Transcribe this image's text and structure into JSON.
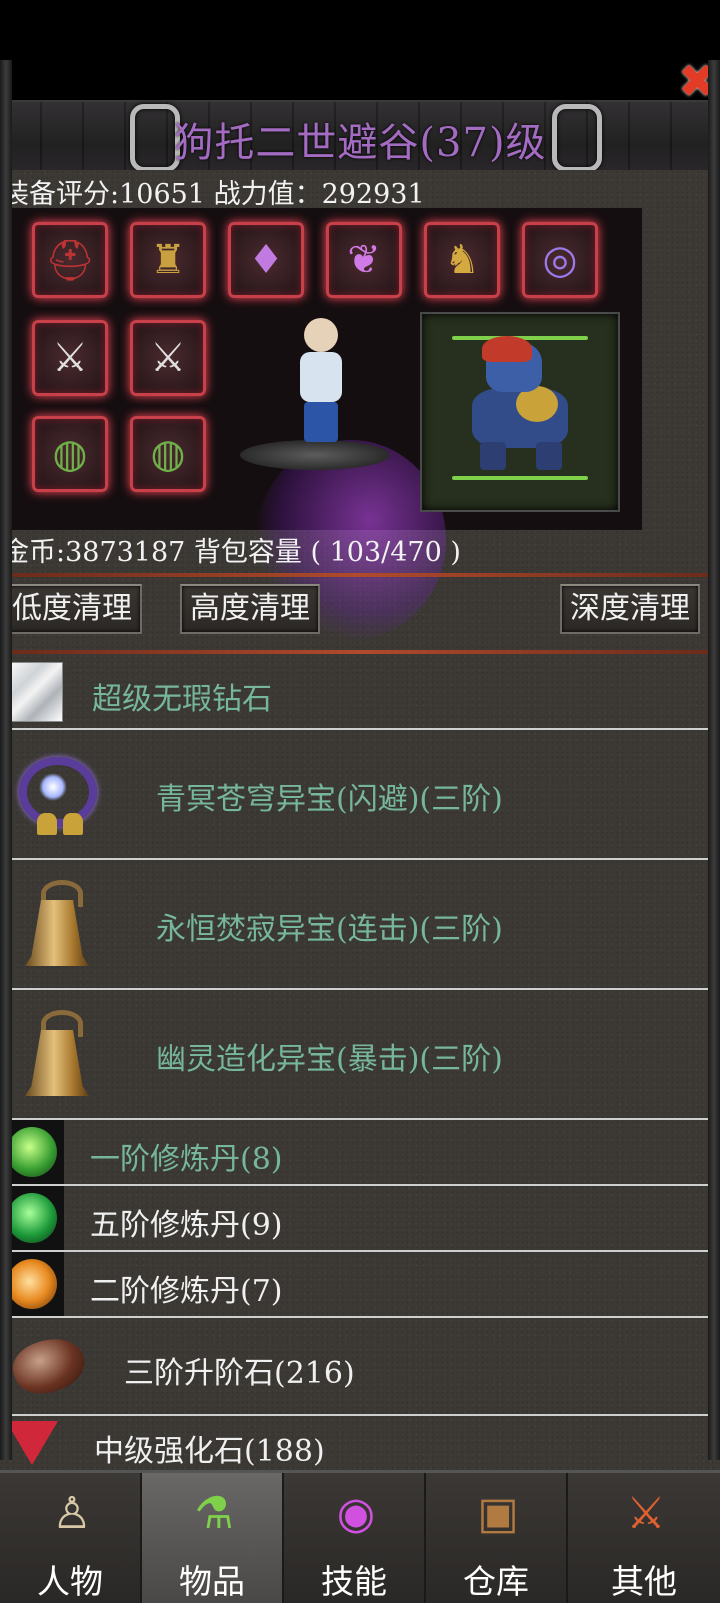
{
  "window": {
    "title": "狗托二世避谷(37)级",
    "close_icon": "close-icon",
    "accent_color": "#a36cc2"
  },
  "stats": {
    "text": "装备评分:10651 战力值：292931"
  },
  "equipment": {
    "slots": [
      {
        "name": "helmet-slot",
        "icon": "helmet-icon"
      },
      {
        "name": "armor-slot",
        "icon": "armor-icon"
      },
      {
        "name": "necklace-slot",
        "icon": "necklace-icon"
      },
      {
        "name": "wings-slot",
        "icon": "wings-icon"
      },
      {
        "name": "boots-slot",
        "icon": "boots-icon"
      },
      {
        "name": "treasure-slot",
        "icon": "ring-treasure-icon"
      },
      {
        "name": "weapon-slot-1",
        "icon": "sword-icon"
      },
      {
        "name": "weapon-slot-2",
        "icon": "sword-icon"
      },
      {
        "name": "bracelet-slot-1",
        "icon": "bracelet-icon"
      },
      {
        "name": "bracelet-slot-2",
        "icon": "bracelet-icon"
      }
    ]
  },
  "gold_line": {
    "text": "金币:3873187 背包容量 ( 103/470 )"
  },
  "buttons": {
    "low_clean": "低度清理",
    "high_clean": "高度清理",
    "deep_clean": "深度清理"
  },
  "items": [
    {
      "name": "超级无瑕钻石",
      "icon": "diamond-icon",
      "color": "green"
    },
    {
      "name": "青冥苍穹异宝(闪避)(三阶)",
      "icon": "ring-treasure-icon",
      "color": "green"
    },
    {
      "name": "永恒焚寂异宝(连击)(三阶)",
      "icon": "bell-icon",
      "color": "green"
    },
    {
      "name": "幽灵造化异宝(暴击)(三阶)",
      "icon": "bell-icon",
      "color": "green"
    },
    {
      "name": "一阶修炼丹(8)",
      "icon": "green-orb-icon",
      "color": "green"
    },
    {
      "name": "五阶修炼丹(9)",
      "icon": "green-orb-icon",
      "color": "white"
    },
    {
      "name": "二阶修炼丹(7)",
      "icon": "orange-orb-icon",
      "color": "white"
    },
    {
      "name": "三阶升阶石(216)",
      "icon": "stone-icon",
      "color": "white"
    },
    {
      "name": "中级强化石(188)",
      "icon": "red-gem-icon",
      "color": "white"
    }
  ],
  "tabs": [
    {
      "label": "人物",
      "icon": "character-icon"
    },
    {
      "label": "物品",
      "icon": "potion-icon",
      "active": true
    },
    {
      "label": "技能",
      "icon": "skill-orb-icon"
    },
    {
      "label": "仓库",
      "icon": "chest-icon"
    },
    {
      "label": "其他",
      "icon": "other-icon"
    }
  ]
}
